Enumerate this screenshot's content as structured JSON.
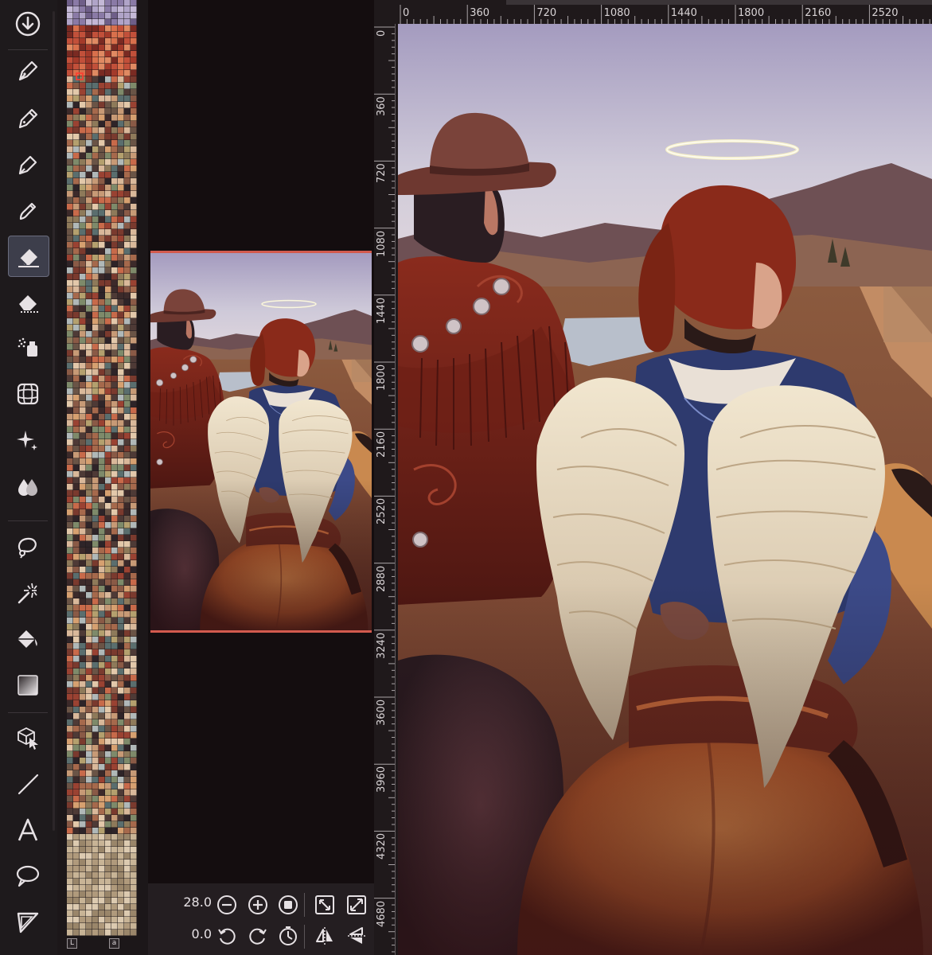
{
  "app": {
    "accent": "#d35a4e",
    "active_tool_bg": "#3d3e4b"
  },
  "toolbar": {
    "tools": [
      {
        "name": "import-icon"
      },
      {
        "name": "pen-tool-icon"
      },
      {
        "name": "pencil-tool-icon"
      },
      {
        "name": "ink-pen-icon"
      },
      {
        "name": "brush-pen-icon"
      },
      {
        "name": "eraser-icon",
        "active": true
      },
      {
        "name": "soft-eraser-icon"
      },
      {
        "name": "airbrush-icon"
      },
      {
        "name": "perspective-grid-icon"
      },
      {
        "name": "sparkle-effect-icon"
      },
      {
        "name": "blend-drops-icon"
      },
      {
        "name": "lasso-select-icon"
      },
      {
        "name": "magic-wand-icon"
      },
      {
        "name": "paint-bucket-icon"
      },
      {
        "name": "gradient-icon"
      },
      {
        "name": "transform-icon"
      },
      {
        "name": "line-tool-icon"
      },
      {
        "name": "text-tool-icon"
      },
      {
        "name": "speech-bubble-icon"
      },
      {
        "name": "frame-border-icon"
      }
    ]
  },
  "palette": {
    "footer_left": "L",
    "footer_right": "a"
  },
  "navigator": {
    "zoom_value": "28.0",
    "rotation_value": "0.0"
  },
  "rulers": {
    "top_labels": [
      "0",
      "360",
      "720",
      "1080",
      "1440",
      "1800",
      "2160",
      "2520"
    ],
    "left_labels": [
      "0",
      "360",
      "720",
      "1080",
      "1440",
      "1800",
      "2160",
      "2520",
      "2880",
      "3240",
      "3600",
      "3960",
      "4320",
      "4680"
    ]
  }
}
